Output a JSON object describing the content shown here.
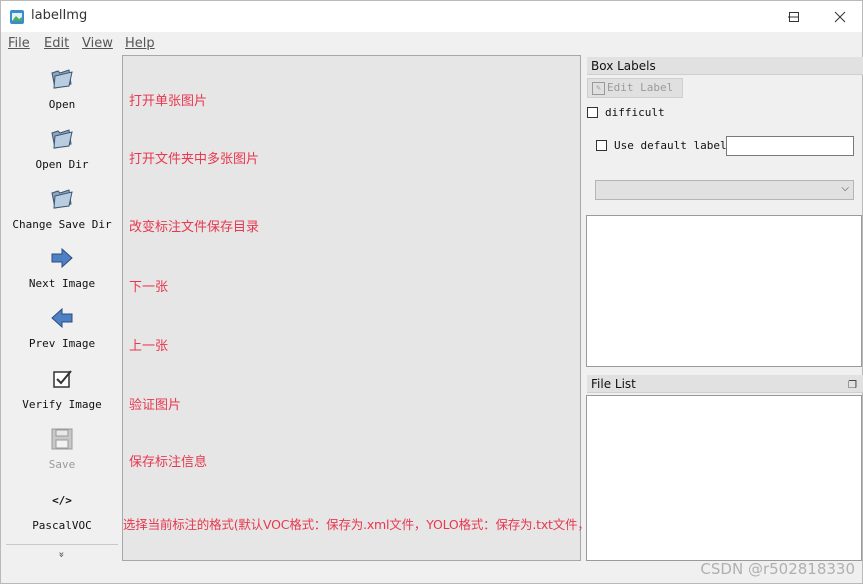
{
  "window": {
    "title": "labelImg",
    "minimize_icon": "minimize-icon",
    "maximize_icon": "maximize-icon",
    "close_icon": "close-icon"
  },
  "menu": [
    {
      "label": "File"
    },
    {
      "label": "Edit"
    },
    {
      "label": "View"
    },
    {
      "label": "Help"
    }
  ],
  "toolbar": {
    "open": {
      "label": "Open",
      "icon": "folder-open-icon"
    },
    "open_dir": {
      "label": "Open Dir",
      "icon": "folder-open-icon"
    },
    "change_save_dir": {
      "label": "Change Save Dir",
      "icon": "folder-open-icon"
    },
    "next_image": {
      "label": "Next Image",
      "icon": "arrow-right-icon"
    },
    "prev_image": {
      "label": "Prev Image",
      "icon": "arrow-left-icon"
    },
    "verify_image": {
      "label": "Verify Image",
      "icon": "checkbox-icon"
    },
    "save": {
      "label": "Save",
      "icon": "floppy-disk-icon"
    },
    "format": {
      "label": "PascalVOC",
      "icon": "code-icon"
    },
    "more": "»"
  },
  "annotations": {
    "open": "打开单张图片",
    "open_dir": "打开文件夹中多张图片",
    "change_save_dir": "改变标注文件保存目录",
    "next_image": "下一张",
    "prev_image": "上一张",
    "verify_image": "验证图片",
    "save": "保存标注信息",
    "format": "选择当前标注的格式(默认VOC格式：保存为.xml文件，YOLO格式：保存为.txt文件，CreateML格式：保存为.josn文件)"
  },
  "box_labels": {
    "title": "Box Labels",
    "edit_label": "Edit Label",
    "difficult": "difficult",
    "use_default_label": "Use default label",
    "default_label_value": ""
  },
  "file_list": {
    "title": "File List"
  },
  "watermark": "CSDN @r502818330",
  "colors": {
    "annotation_text": "#e8374e",
    "canvas_bg": "#e6e6e6"
  }
}
